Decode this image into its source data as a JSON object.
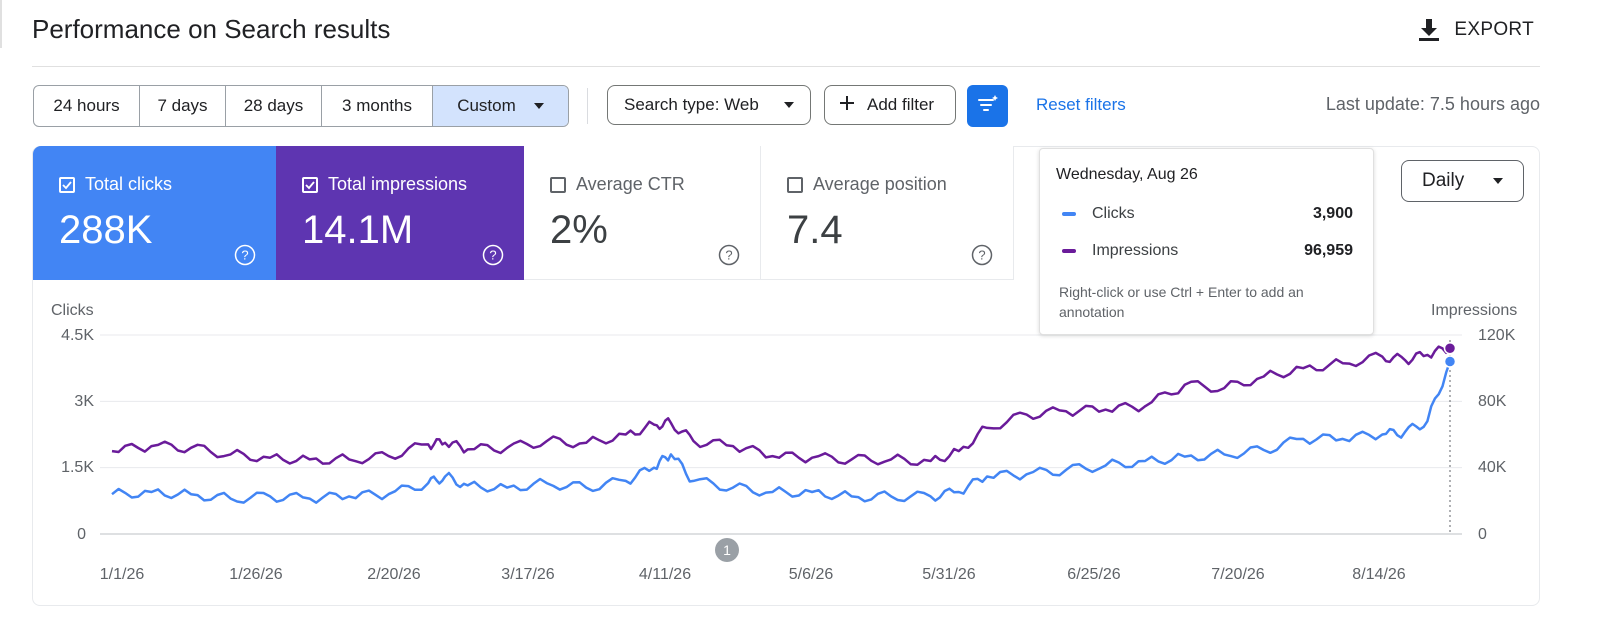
{
  "header": {
    "title": "Performance on Search results",
    "export_label": "EXPORT"
  },
  "toolbar": {
    "date_ranges": [
      "24 hours",
      "7 days",
      "28 days",
      "3 months",
      "Custom"
    ],
    "selected_range": "Custom",
    "search_type": "Search type: Web",
    "add_filter": "Add filter",
    "reset_filters": "Reset filters",
    "last_update": "Last update: 7.5 hours ago"
  },
  "metrics": [
    {
      "label": "Total clicks",
      "value": "288K",
      "checked": true,
      "color": "#4285f4"
    },
    {
      "label": "Total impressions",
      "value": "14.1M",
      "checked": true,
      "color": "#5e35b1"
    },
    {
      "label": "Average CTR",
      "value": "2%",
      "checked": false
    },
    {
      "label": "Average position",
      "value": "7.4",
      "checked": false
    }
  ],
  "granularity": "Daily",
  "tooltip": {
    "date": "Wednesday, Aug 26",
    "rows": [
      {
        "name": "Clicks",
        "value": "3,900",
        "color": "#4285f4"
      },
      {
        "name": "Impressions",
        "value": "96,959",
        "color": "#6a1b9a"
      }
    ],
    "note": "Right-click or use Ctrl + Enter to add an annotation"
  },
  "annotation_marker": "1",
  "chart_data": {
    "type": "line",
    "ylabel_left": "Clicks",
    "ylabel_right": "Impressions",
    "y_left_ticks": [
      "0",
      "1.5K",
      "3K",
      "4.5K"
    ],
    "y_right_ticks": [
      "0",
      "40K",
      "80K",
      "120K"
    ],
    "ylim_left": [
      0,
      4500
    ],
    "ylim_right": [
      0,
      120000
    ],
    "x_ticks": [
      "1/1/26",
      "1/26/26",
      "2/20/26",
      "3/17/26",
      "4/11/26",
      "5/6/26",
      "5/31/26",
      "6/25/26",
      "7/20/26",
      "8/14/26"
    ],
    "grid": true,
    "series": [
      {
        "name": "Clicks",
        "axis": "left",
        "color": "#4285f4",
        "points": [
          [
            "2026-01-01",
            900
          ],
          [
            "2026-01-08",
            950
          ],
          [
            "2026-01-15",
            900
          ],
          [
            "2026-01-22",
            800
          ],
          [
            "2026-01-29",
            850
          ],
          [
            "2026-02-05",
            800
          ],
          [
            "2026-02-12",
            850
          ],
          [
            "2026-02-19",
            900
          ],
          [
            "2026-02-26",
            1150
          ],
          [
            "2026-03-01",
            1300
          ],
          [
            "2026-03-05",
            1100
          ],
          [
            "2026-03-12",
            1050
          ],
          [
            "2026-03-19",
            1150
          ],
          [
            "2026-03-26",
            1050
          ],
          [
            "2026-04-02",
            1200
          ],
          [
            "2026-04-07",
            1500
          ],
          [
            "2026-04-10",
            1800
          ],
          [
            "2026-04-14",
            1200
          ],
          [
            "2026-04-21",
            1050
          ],
          [
            "2026-04-28",
            950
          ],
          [
            "2026-05-05",
            950
          ],
          [
            "2026-05-12",
            850
          ],
          [
            "2026-05-19",
            850
          ],
          [
            "2026-05-26",
            850
          ],
          [
            "2026-05-31",
            950
          ],
          [
            "2026-06-05",
            1300
          ],
          [
            "2026-06-12",
            1350
          ],
          [
            "2026-06-19",
            1450
          ],
          [
            "2026-06-26",
            1550
          ],
          [
            "2026-07-03",
            1650
          ],
          [
            "2026-07-10",
            1750
          ],
          [
            "2026-07-17",
            1800
          ],
          [
            "2026-07-24",
            1900
          ],
          [
            "2026-07-31",
            2150
          ],
          [
            "2026-08-07",
            2150
          ],
          [
            "2026-08-14",
            2250
          ],
          [
            "2026-08-18",
            2300
          ],
          [
            "2026-08-22",
            2550
          ],
          [
            "2026-08-26",
            3900
          ]
        ]
      },
      {
        "name": "Impressions",
        "axis": "right",
        "color": "#6a1b9a",
        "points": [
          [
            "2026-01-01",
            50000
          ],
          [
            "2026-01-08",
            53000
          ],
          [
            "2026-01-15",
            52000
          ],
          [
            "2026-01-22",
            48000
          ],
          [
            "2026-01-29",
            46000
          ],
          [
            "2026-02-05",
            45000
          ],
          [
            "2026-02-12",
            45000
          ],
          [
            "2026-02-19",
            47000
          ],
          [
            "2026-02-26",
            54000
          ],
          [
            "2026-03-01",
            55000
          ],
          [
            "2026-03-05",
            51000
          ],
          [
            "2026-03-12",
            52000
          ],
          [
            "2026-03-19",
            56000
          ],
          [
            "2026-03-26",
            55000
          ],
          [
            "2026-04-02",
            60000
          ],
          [
            "2026-04-07",
            66000
          ],
          [
            "2026-04-10",
            67000
          ],
          [
            "2026-04-14",
            56000
          ],
          [
            "2026-04-21",
            53000
          ],
          [
            "2026-04-28",
            47000
          ],
          [
            "2026-05-05",
            46000
          ],
          [
            "2026-05-12",
            45000
          ],
          [
            "2026-05-19",
            45000
          ],
          [
            "2026-05-26",
            44000
          ],
          [
            "2026-05-31",
            50000
          ],
          [
            "2026-06-05",
            64000
          ],
          [
            "2026-06-12",
            72000
          ],
          [
            "2026-06-19",
            74000
          ],
          [
            "2026-06-26",
            75000
          ],
          [
            "2026-07-03",
            77000
          ],
          [
            "2026-07-10",
            90000
          ],
          [
            "2026-07-17",
            88000
          ],
          [
            "2026-07-24",
            95000
          ],
          [
            "2026-07-31",
            100000
          ],
          [
            "2026-08-07",
            103000
          ],
          [
            "2026-08-14",
            107000
          ],
          [
            "2026-08-18",
            105000
          ],
          [
            "2026-08-22",
            108000
          ],
          [
            "2026-08-26",
            112000
          ]
        ]
      }
    ]
  }
}
